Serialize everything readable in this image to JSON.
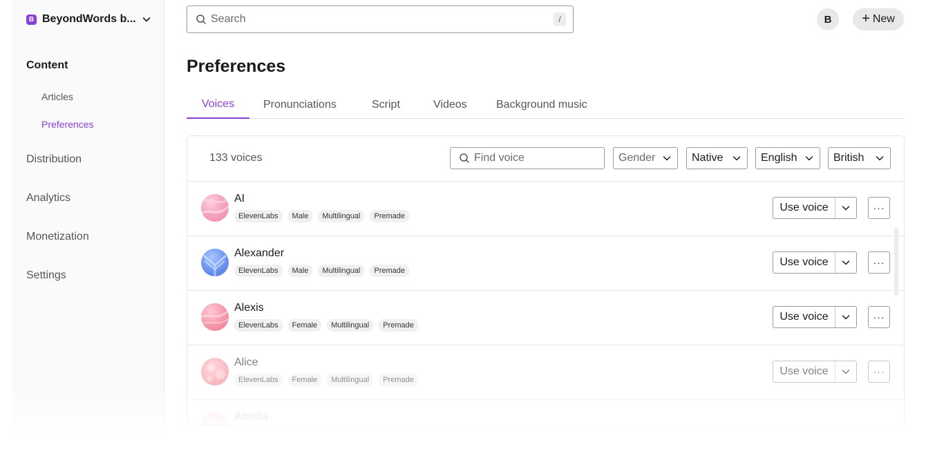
{
  "workspace": {
    "badge": "B",
    "name": "BeyondWords b..."
  },
  "sidebar": {
    "content": "Content",
    "sub_items": [
      {
        "label": "Articles"
      },
      {
        "label": "Preferences"
      }
    ],
    "sections": [
      {
        "label": "Distribution"
      },
      {
        "label": "Analytics"
      },
      {
        "label": "Monetization"
      },
      {
        "label": "Settings"
      }
    ]
  },
  "search": {
    "placeholder": "Search",
    "shortcut": "/"
  },
  "user": {
    "avatar_letter": "B"
  },
  "new_button": {
    "label": "New",
    "icon": "plus-icon"
  },
  "page": {
    "title": "Preferences"
  },
  "tabs": [
    {
      "label": "Voices",
      "active": true
    },
    {
      "label": "Pronunciations"
    },
    {
      "label": "Script"
    },
    {
      "label": "Videos"
    },
    {
      "label": "Background music"
    }
  ],
  "voices_panel": {
    "count": "133 voices",
    "find_placeholder": "Find voice",
    "filters": {
      "gender": "Gender",
      "native": "Native",
      "language": "English",
      "accent": "British"
    }
  },
  "voice_rows": [
    {
      "name": "AI",
      "tags": [
        "ElevenLabs",
        "Male",
        "Multilingual",
        "Premade"
      ],
      "use_label": "Use voice",
      "more": "···"
    },
    {
      "name": "Alexander",
      "tags": [
        "ElevenLabs",
        "Male",
        "Multilingual",
        "Premade"
      ],
      "use_label": "Use voice",
      "more": "···"
    },
    {
      "name": "Alexis",
      "tags": [
        "ElevenLabs",
        "Female",
        "Multilingual",
        "Premade"
      ],
      "use_label": "Use voice",
      "more": "···"
    },
    {
      "name": "Alice",
      "tags": [
        "ElevenLabs",
        "Female",
        "Multilingual",
        "Premade"
      ],
      "use_label": "Use voice",
      "more": "···"
    },
    {
      "name": "Amelia"
    }
  ],
  "colors": {
    "accent": "#8b3fd9",
    "border": "#9a9a9a",
    "tag_bg": "#f0f0f0"
  }
}
